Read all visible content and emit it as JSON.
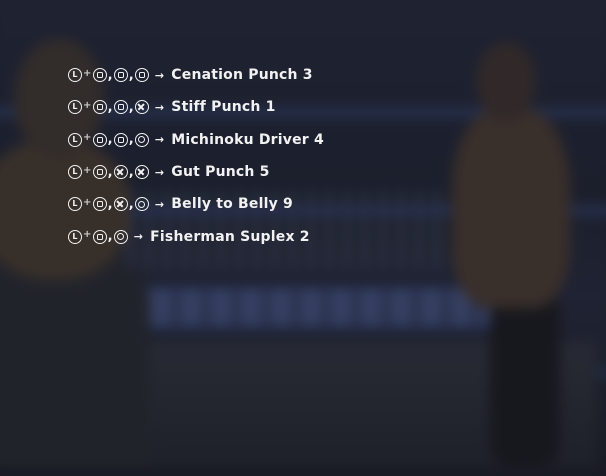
{
  "moves": [
    {
      "trigger": "L",
      "buttons": [
        "square",
        "square",
        "square"
      ],
      "name": "Cenation Punch 3"
    },
    {
      "trigger": "L",
      "buttons": [
        "square",
        "square",
        "cross"
      ],
      "name": "Stiff Punch 1"
    },
    {
      "trigger": "L",
      "buttons": [
        "square",
        "square",
        "circle"
      ],
      "name": "Michinoku Driver 4"
    },
    {
      "trigger": "L",
      "buttons": [
        "square",
        "cross",
        "cross"
      ],
      "name": "Gut Punch 5"
    },
    {
      "trigger": "L",
      "buttons": [
        "square",
        "cross",
        "circle"
      ],
      "name": "Belly to Belly 9"
    },
    {
      "trigger": "L",
      "buttons": [
        "square",
        "circle"
      ],
      "name": "Fisherman Suplex 2"
    }
  ],
  "glyphs": {
    "plus": "+",
    "comma": ",",
    "arrow": "→"
  },
  "colors": {
    "text": "#f2f2f2",
    "rope": "#3a4a7a",
    "banner": "#4b5c96"
  }
}
